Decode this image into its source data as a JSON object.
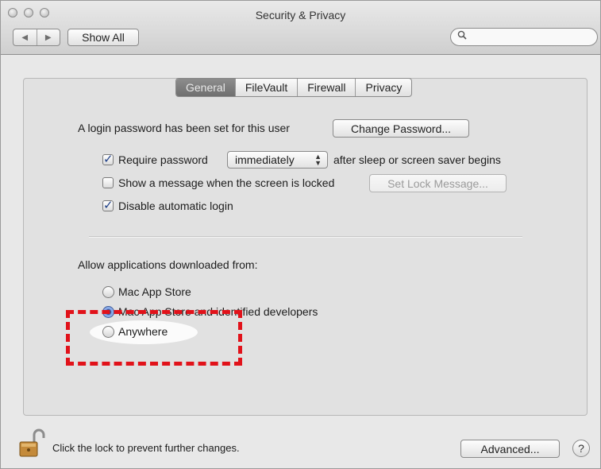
{
  "window": {
    "title": "Security & Privacy"
  },
  "toolbar": {
    "back_icon": "◀",
    "forward_icon": "▶",
    "show_all_label": "Show All",
    "search_placeholder": ""
  },
  "tabs": [
    {
      "label": "General",
      "selected": true
    },
    {
      "label": "FileVault",
      "selected": false
    },
    {
      "label": "Firewall",
      "selected": false
    },
    {
      "label": "Privacy",
      "selected": false
    }
  ],
  "general": {
    "login_password_text": "A login password has been set for this user",
    "change_password_label": "Change Password...",
    "require_password": {
      "label": "Require password",
      "checked": true,
      "select_value": "immediately",
      "suffix": "after sleep or screen saver begins"
    },
    "show_message": {
      "label": "Show a message when the screen is locked",
      "checked": false,
      "button_label": "Set Lock Message..."
    },
    "disable_auto_login": {
      "label": "Disable automatic login",
      "checked": true
    }
  },
  "downloads": {
    "heading": "Allow applications downloaded from:",
    "options": [
      {
        "label": "Mac App Store",
        "selected": false
      },
      {
        "label": "Mac App Store and identified developers",
        "selected": true
      },
      {
        "label": "Anywhere",
        "selected": false
      }
    ]
  },
  "footer": {
    "lock_text": "Click the lock to prevent further changes.",
    "advanced_label": "Advanced...",
    "help_label": "?"
  },
  "colors": {
    "annotation": "#e1121a",
    "selected_tab": "#7a7a7a",
    "checkmark": "#1e3f87"
  }
}
